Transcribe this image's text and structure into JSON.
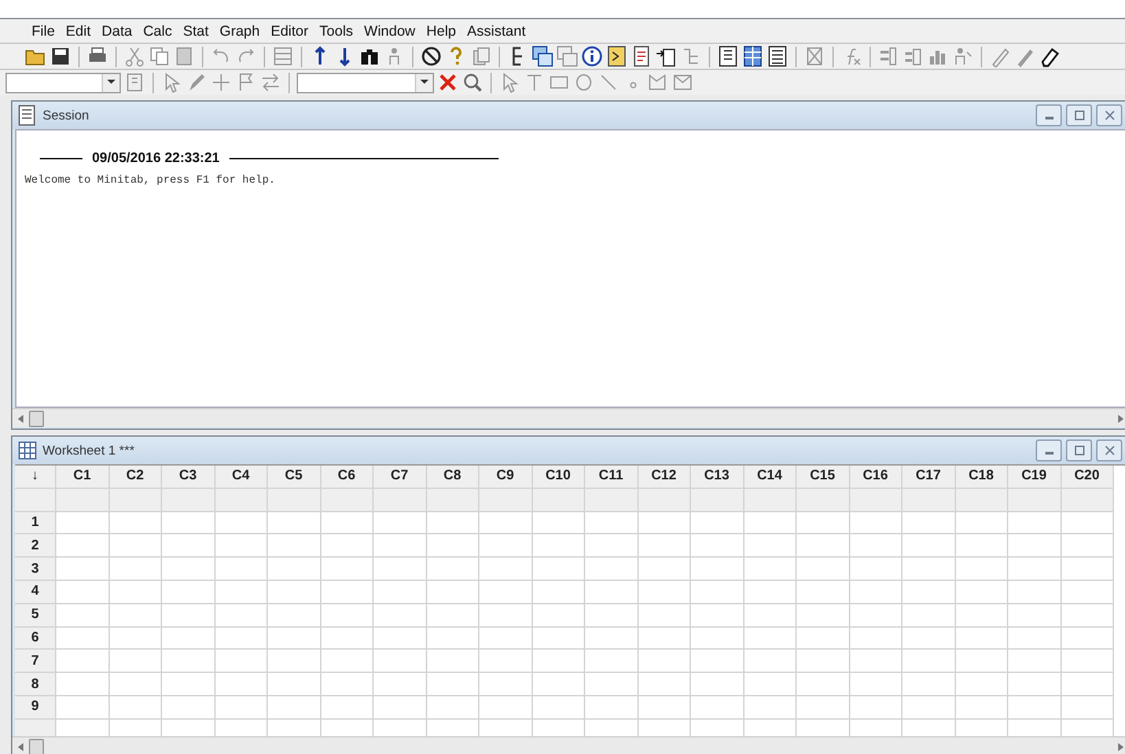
{
  "menu": [
    {
      "label": "File"
    },
    {
      "label": "Edit"
    },
    {
      "label": "Data"
    },
    {
      "label": "Calc"
    },
    {
      "label": "Stat"
    },
    {
      "label": "Graph"
    },
    {
      "label": "Editor"
    },
    {
      "label": "Tools"
    },
    {
      "label": "Window"
    },
    {
      "label": "Help"
    },
    {
      "label": "Assistant"
    }
  ],
  "session": {
    "title": "Session",
    "timestamp": "09/05/2016 22:33:21",
    "lines": [
      "Welcome to Minitab, press F1 for help."
    ]
  },
  "worksheet": {
    "title": "Worksheet 1 ***",
    "corner": "↓",
    "columns": [
      "C1",
      "C2",
      "C3",
      "C4",
      "C5",
      "C6",
      "C7",
      "C8",
      "C9",
      "C10",
      "C11",
      "C12",
      "C13",
      "C14",
      "C15",
      "C16",
      "C17",
      "C18",
      "C19",
      "C20"
    ],
    "rows": [
      "1",
      "2",
      "3",
      "4",
      "5",
      "6",
      "7",
      "8",
      "9"
    ]
  }
}
